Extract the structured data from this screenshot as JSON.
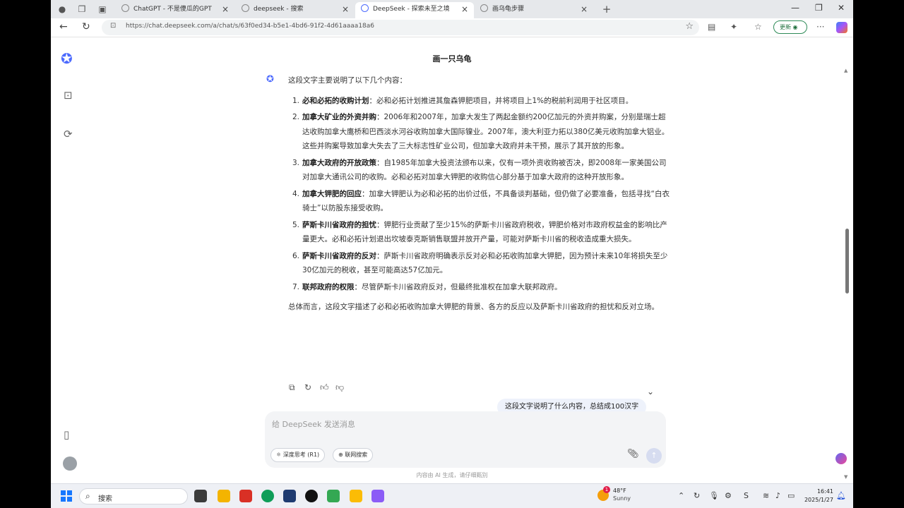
{
  "browser": {
    "tabs": [
      {
        "title": "ChatGPT - 不是傻瓜的GPT",
        "active": false
      },
      {
        "title": "deepseek - 搜索",
        "active": false
      },
      {
        "title": "DeepSeek - 探索未至之境",
        "active": true
      },
      {
        "title": "画乌龟步骤",
        "active": false
      }
    ],
    "new_tab": "+",
    "url": "https://chat.deepseek.com/a/chat/s/63f0ed34-b5e1-4bd6-91f2-4d61aaaa18a6",
    "update_label": "更新"
  },
  "chat": {
    "title": "画一只乌龟",
    "intro": "这段文字主要说明了以下几个内容：",
    "points": [
      {
        "num": "1.",
        "head": "必和必拓的收购计划",
        "body": "：必和必拓计划推进其詹森钾肥项目，并将项目上1%的税前利润用于社区项目。"
      },
      {
        "num": "2.",
        "head": "加拿大矿业的外资并购",
        "body": "：2006年和2007年，加拿大发生了两起金额约200亿加元的外资并购案，分别是瑞士超达收购加拿大鹰桥和巴西淡水河谷收购加拿大国际镍业。2007年，澳大利亚力拓以380亿美元收购加拿大铝业。这些并购案导致加拿大失去了三大标志性矿业公司，但加拿大政府并未干预，展示了其开放的形象。"
      },
      {
        "num": "3.",
        "head": "加拿大政府的开放政策",
        "body": "：自1985年加拿大投资法颁布以来，仅有一项外资收购被否决，即2008年一家美国公司对加拿大通讯公司的收购。必和必拓对加拿大钾肥的收购信心部分基于加拿大政府的这种开放形象。"
      },
      {
        "num": "4.",
        "head": "加拿大钾肥的回应",
        "body": "：加拿大钾肥认为必和必拓的出价过低，不具备谈判基础，但仍做了必要准备，包括寻找“白衣骑士”以防股东接受收购。"
      },
      {
        "num": "5.",
        "head": "萨斯卡川省政府的担忧",
        "body": "：钾肥行业贡献了至少15%的萨斯卡川省政府税收，钾肥价格对市政府权益金的影响比产量更大。必和必拓计划退出坎坡泰克斯销售联盟并放开产量，可能对萨斯卡川省的税收造成重大损失。"
      },
      {
        "num": "6.",
        "head": "萨斯卡川省政府的反对",
        "body": "：萨斯卡川省政府明确表示反对必和必拓收购加拿大钾肥，因为预计未来10年将损失至少30亿加元的税收，甚至可能高达57亿加元。"
      },
      {
        "num": "7.",
        "head": "联邦政府的权限",
        "body": "：尽管萨斯卡川省政府反对，但最终批准权在加拿大联邦政府。"
      }
    ],
    "summary": "总体而言，这段文字描述了必和必拓收购加拿大钾肥的背景、各方的反应以及萨斯卡川省政府的担忧和反对立场。",
    "user_message": "这段文字说明了什么内容，总结成100汉字"
  },
  "composer": {
    "placeholder": "给 DeepSeek 发送消息",
    "deep_think": "深度思考 (R1)",
    "web_search": "联网搜索"
  },
  "disclaimer": "内容由 AI 生成，请仔细甄别",
  "taskbar": {
    "search_label": "搜索",
    "weather_badge": "1",
    "temperature": "48°F",
    "condition": "Sunny",
    "time": "16:41",
    "date": "2025/1/27"
  },
  "colors": {
    "accent": "#4d6bfe",
    "user_bubble": "#eef2fb",
    "composer_bg": "#f3f4f6"
  }
}
